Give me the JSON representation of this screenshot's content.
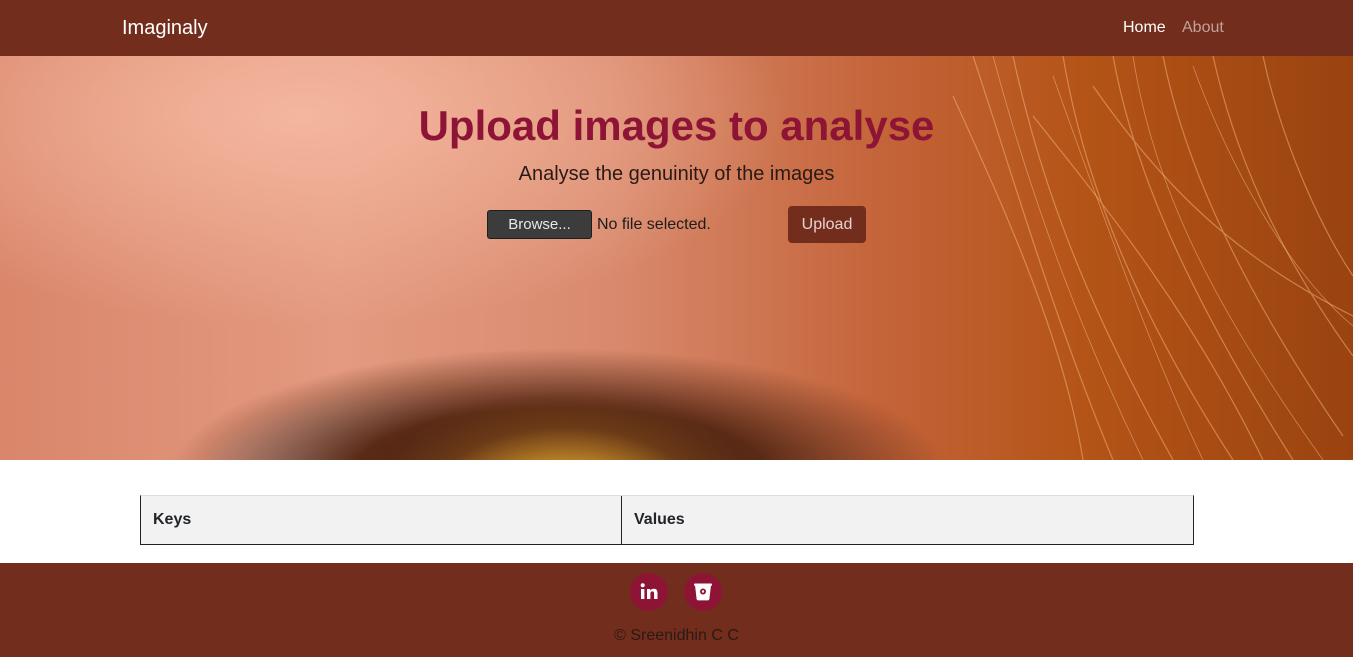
{
  "navbar": {
    "brand": "Imaginaly",
    "links": [
      {
        "label": "Home",
        "active": true
      },
      {
        "label": "About",
        "active": false
      }
    ]
  },
  "hero": {
    "title": "Upload images to analyse",
    "subtitle": "Analyse the genuinity of the images",
    "file_input": {
      "button_label": "Browse...",
      "status": "No file selected."
    },
    "upload_label": "Upload"
  },
  "results_table": {
    "headers": [
      "Keys",
      "Values"
    ],
    "rows": []
  },
  "footer": {
    "social": [
      {
        "icon": "linkedin-icon"
      },
      {
        "icon": "bucket-icon"
      }
    ],
    "copyright": "© Sreenidhin C C"
  },
  "colors": {
    "navbar": "#732d1c",
    "accent": "#8e1436",
    "table_header_bg": "#f2f2f2"
  }
}
